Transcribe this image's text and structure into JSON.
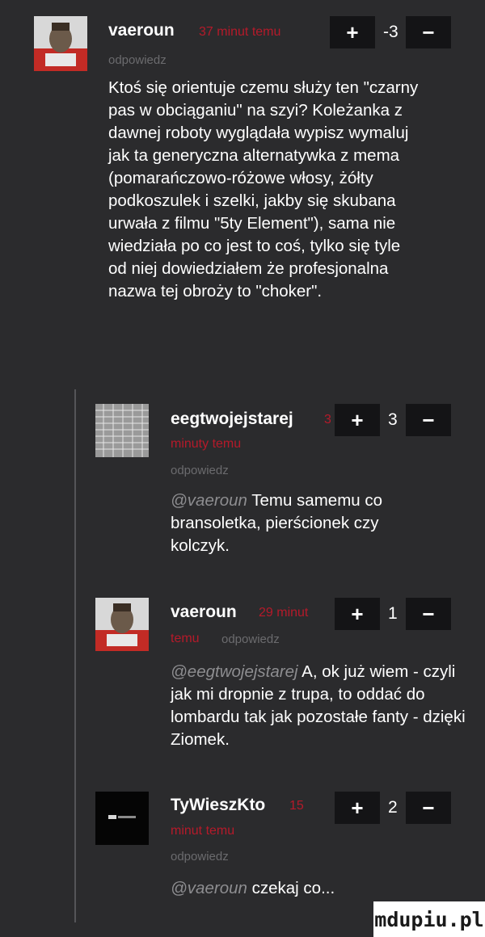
{
  "comments": [
    {
      "username": "vaeroun",
      "time": "37 minut temu",
      "reply": "odpowiedz",
      "score": "-3",
      "text": "Ktoś się orientuje czemu służy ten \"czarny pas w obciąganiu\" na szyi? Koleżanka z dawnej roboty wyglądała wypisz wymaluj jak ta generyczna alternatywka z mema (pomarańczowo-różowe włosy, żółty podkoszulek i szelki, jakby się skubana urwała z filmu \"5ty Element\"), sama nie wiedziała po co jest to coś, tylko się tyle od niej dowiedziałem że profesjonalna nazwa tej obroży to \"choker\"."
    },
    {
      "username": "eegtwojejstarej",
      "time_cut": "3",
      "time": "minuty temu",
      "reply": "odpowiedz",
      "score": "3",
      "mention": "@vaeroun",
      "text": "Temu samemu co bransoletka, pierścionek czy kolczyk."
    },
    {
      "username": "vaeroun",
      "time": "29 minut",
      "time2": "temu",
      "reply": "odpowiedz",
      "score": "1",
      "mention": "@eegtwojejstarej",
      "text": "A, ok już wiem - czyli jak mi dropnie z trupa, to oddać do lombardu tak jak pozostałe fanty - dzięki Ziomek."
    },
    {
      "username": "TyWieszKto",
      "time_cut": "15",
      "time": "minut temu",
      "reply": "odpowiedz",
      "score": "2",
      "mention": "@vaeroun",
      "text": "czekaj co..."
    }
  ],
  "vote": {
    "plus": "+",
    "minus": "−"
  },
  "watermark": "mdupiu.pl",
  "colors": {
    "background": "#2b2b2d",
    "time": "#b51a2a",
    "muted": "#6b6b6e"
  }
}
